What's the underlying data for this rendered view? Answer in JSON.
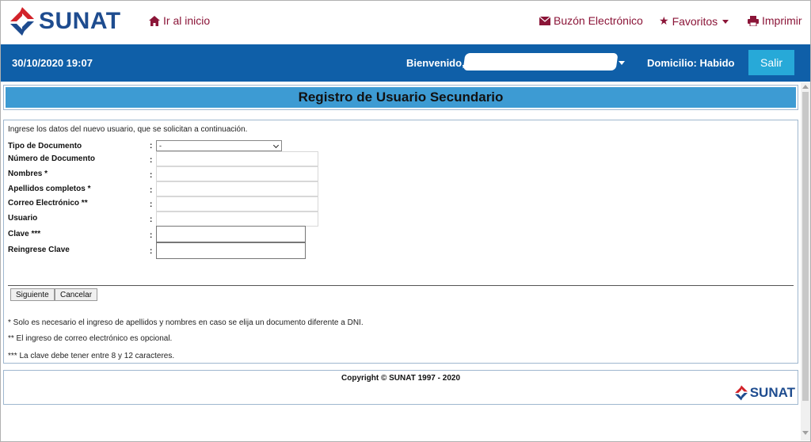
{
  "header": {
    "logo_text": "SUNAT",
    "home_link": "Ir al inicio",
    "mailbox_link": "Buzón Electrónico",
    "favorites_link": "Favoritos",
    "print_link": "Imprimir",
    "accent_color": "#8b1538",
    "brand_color": "#1e4c8f"
  },
  "userbar": {
    "datetime": "30/10/2020 19:07",
    "welcome": "Bienvenido,",
    "domicile": "Domicilio: Habido",
    "logout_label": "Salir",
    "bar_color": "#0f5fa8"
  },
  "page": {
    "title": "Registro de Usuario Secundario"
  },
  "form": {
    "intro": "Ingrese los datos del nuevo usuario, que se solicitan a continuación.",
    "fields": [
      {
        "label": "Tipo de Documento",
        "type": "select",
        "value": "-"
      },
      {
        "label": "Número de Documento",
        "type": "text",
        "value": ""
      },
      {
        "label": "Nombres *",
        "type": "text",
        "value": ""
      },
      {
        "label": "Apellidos completos *",
        "type": "text",
        "value": ""
      },
      {
        "label": "Correo Electrónico **",
        "type": "text",
        "value": ""
      },
      {
        "label": "Usuario",
        "type": "text",
        "value": ""
      },
      {
        "label": "Clave ***",
        "type": "password",
        "value": ""
      },
      {
        "label": "Reingrese Clave",
        "type": "password",
        "value": ""
      }
    ],
    "colon": ":",
    "next_label": "Siguiente",
    "cancel_label": "Cancelar",
    "notes": [
      "* Solo es necesario el ingreso de apellidos y nombres en caso se elija un documento diferente a DNI.",
      "** El ingreso de correo electrónico es opcional.",
      "*** La clave debe tener entre 8 y 12 caracteres."
    ]
  },
  "footer": {
    "copyright": "Copyright © SUNAT 1997 - 2020",
    "logo_text": "SUNAT"
  }
}
